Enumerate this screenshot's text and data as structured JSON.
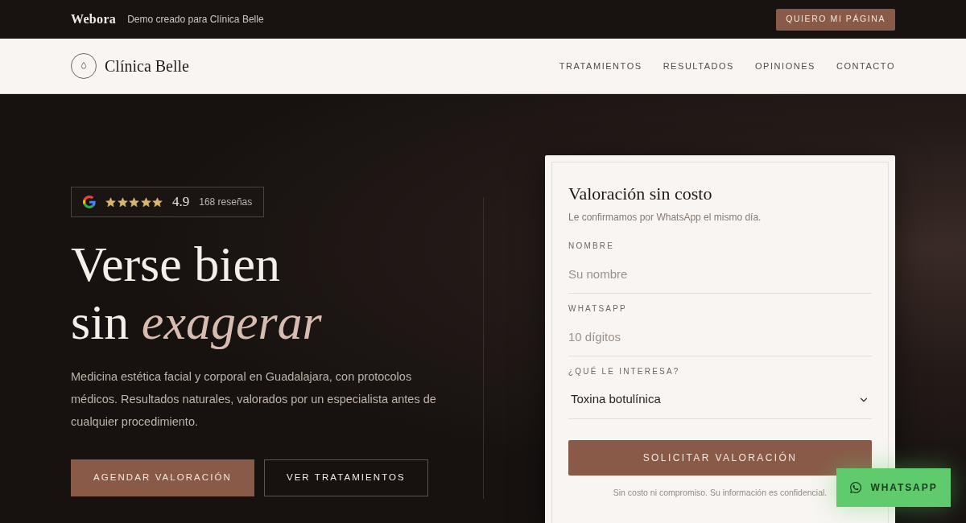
{
  "top_bar": {
    "brand": "Webora",
    "tagline": "Demo creado para Clínica Belle",
    "button": "QUIERO MI PÁGINA"
  },
  "nav": {
    "logo_text": "Clínica Belle",
    "links": [
      "TRATAMIENTOS",
      "RESULTADOS",
      "OPINIONES",
      "CONTACTO"
    ]
  },
  "hero": {
    "rating": {
      "stars": 5,
      "score": "4.9",
      "reviews": "168 reseñas"
    },
    "title_lines": [
      "Verse bien",
      "sin *exagerar*"
    ],
    "description": "Medicina estética facial y corporal en Guadalajara, con protocolos médicos. Resultados naturales, valorados por un especialista antes de cualquier procedimiento.",
    "buttons": [
      {
        "kind": "primary",
        "label": "AGENDAR VALORACIÓN"
      },
      {
        "kind": "outline",
        "label": "VER TRATAMIENTOS"
      }
    ]
  },
  "form": {
    "title": "Valoración sin costo",
    "subtitle": "Le confirmamos por WhatsApp el mismo día.",
    "fields": [
      {
        "kind": "text",
        "label": "NOMBRE",
        "placeholder": "Su nombre"
      },
      {
        "kind": "text",
        "label": "WHATSAPP",
        "placeholder": "10 dígitos"
      },
      {
        "kind": "select",
        "label": "¿QUÉ LE INTERESA?",
        "value": "Toxina botulínica"
      }
    ],
    "submit": "SOLICITAR VALORACIÓN",
    "note": "Sin costo ni compromiso. Su información es confidencial."
  },
  "whatsapp_float": {
    "label": "WHATSAPP"
  }
}
